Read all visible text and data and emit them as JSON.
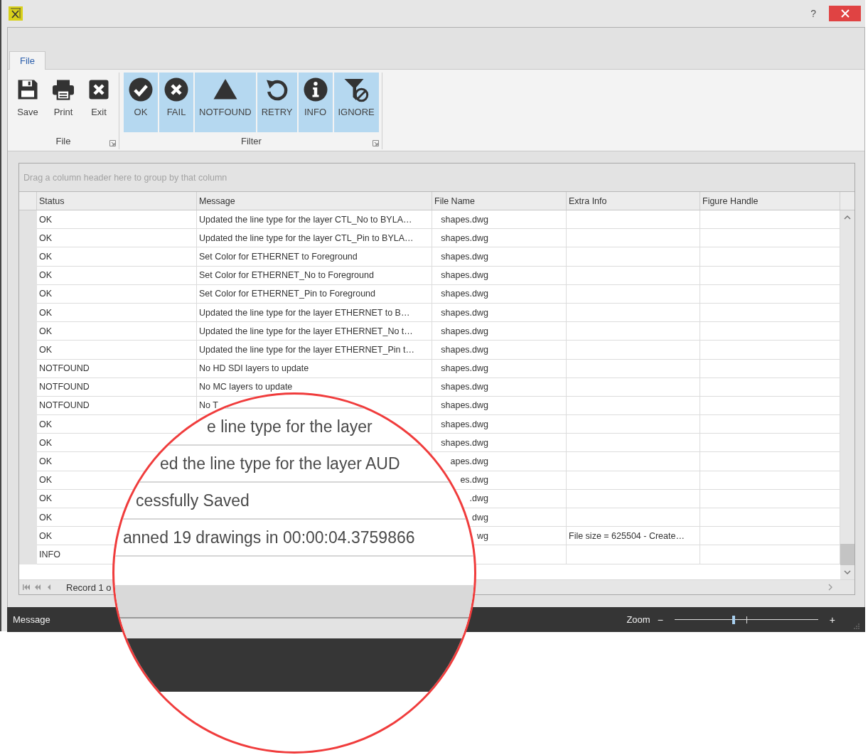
{
  "window": {
    "help": "?"
  },
  "ribbon": {
    "tabs": [
      {
        "label": "File",
        "selected": true
      }
    ],
    "groups": [
      {
        "title": "File",
        "buttons": [
          {
            "label": "Save"
          },
          {
            "label": "Print"
          },
          {
            "label": "Exit"
          }
        ]
      },
      {
        "title": "Filter",
        "buttons": [
          {
            "label": "OK",
            "selected": true
          },
          {
            "label": "FAIL",
            "selected": true
          },
          {
            "label": "NOTFOUND",
            "selected": true
          },
          {
            "label": "RETRY",
            "selected": true
          },
          {
            "label": "INFO",
            "selected": true
          },
          {
            "label": "IGNORE",
            "selected": true
          }
        ]
      }
    ]
  },
  "grid": {
    "group_panel": "Drag a column header here to group by that column",
    "columns": [
      "Status",
      "Message",
      "File Name",
      "Extra Info",
      "Figure Handle"
    ],
    "rows": [
      {
        "status": "OK",
        "message": "Updated the line type for the layer CTL_No to BYLA…",
        "file_name": "shapes.dwg"
      },
      {
        "status": "OK",
        "message": "Updated the line type for the layer CTL_Pin to BYLA…",
        "file_name": "shapes.dwg"
      },
      {
        "status": "OK",
        "message": "Set Color for ETHERNET to Foreground",
        "file_name": "shapes.dwg"
      },
      {
        "status": "OK",
        "message": "Set Color for ETHERNET_No to Foreground",
        "file_name": "shapes.dwg"
      },
      {
        "status": "OK",
        "message": "Set Color for ETHERNET_Pin to Foreground",
        "file_name": "shapes.dwg"
      },
      {
        "status": "OK",
        "message": "Updated the line type for the layer ETHERNET to B…",
        "file_name": "shapes.dwg"
      },
      {
        "status": "OK",
        "message": "Updated the line type for the layer ETHERNET_No t…",
        "file_name": "shapes.dwg"
      },
      {
        "status": "OK",
        "message": "Updated the line type for the layer ETHERNET_Pin t…",
        "file_name": "shapes.dwg"
      },
      {
        "status": "NOTFOUND",
        "message": "No HD SDI layers to update",
        "file_name": "shapes.dwg"
      },
      {
        "status": "NOTFOUND",
        "message": "No MC layers to update",
        "file_name": "shapes.dwg"
      },
      {
        "status": "NOTFOUND",
        "message": "No T",
        "file_name": "shapes.dwg"
      },
      {
        "status": "OK",
        "file_name": "shapes.dwg"
      },
      {
        "status": "OK",
        "file_name": "shapes.dwg"
      },
      {
        "status": "OK",
        "file_name": "apes.dwg"
      },
      {
        "status": "OK",
        "file_name": "es.dwg"
      },
      {
        "status": "OK",
        "file_name": ".dwg"
      },
      {
        "status": "OK",
        "file_name": "dwg"
      },
      {
        "status": "OK",
        "file_name": "wg",
        "extra_info": "File size = 625504 - Create…"
      },
      {
        "status": "INFO"
      }
    ],
    "pager": "Record 1 o"
  },
  "magnifier": {
    "lines": [
      "e line type for the layer",
      "ed the line type for the layer AUD",
      "cessfully Saved",
      "anned 19 drawings in 00:00:04.3759866"
    ]
  },
  "status_bar": {
    "message": "Message",
    "zoom_label": "Zoom",
    "zoom_out": "−",
    "zoom_in": "+",
    "zoom": {
      "level": 0.41
    }
  }
}
